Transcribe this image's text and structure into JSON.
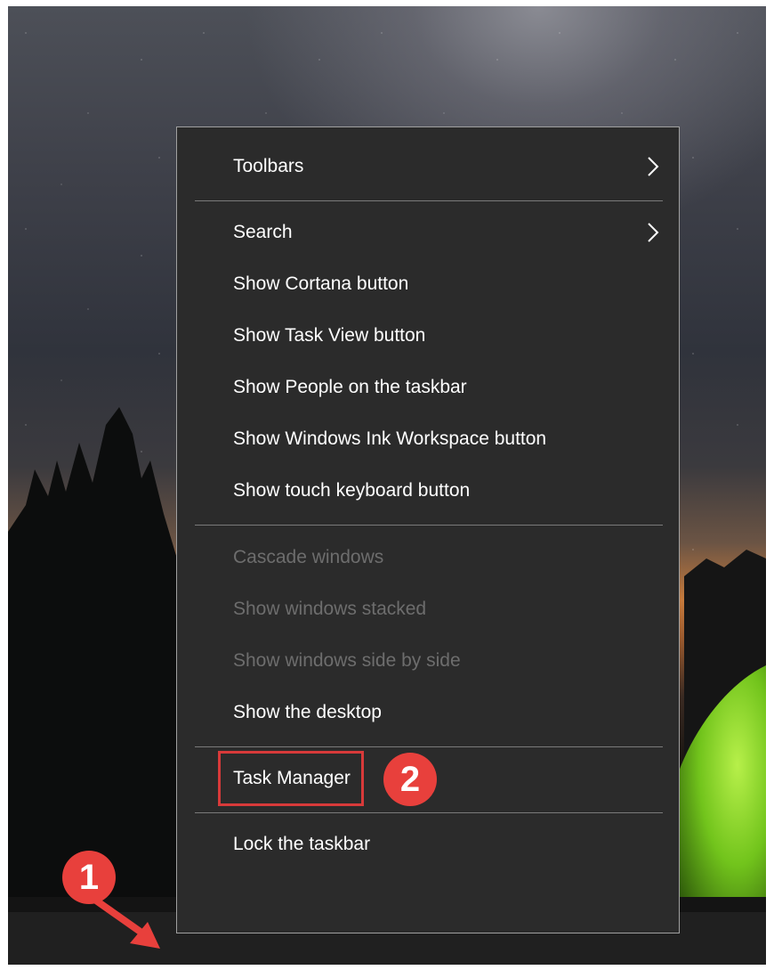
{
  "context_menu": {
    "items": [
      {
        "label": "Toolbars",
        "submenu": true
      },
      {
        "label": "Search",
        "submenu": true
      },
      {
        "label": "Show Cortana button"
      },
      {
        "label": "Show Task View button"
      },
      {
        "label": "Show People on the taskbar"
      },
      {
        "label": "Show Windows Ink Workspace button"
      },
      {
        "label": "Show touch keyboard button"
      },
      {
        "label": "Cascade windows",
        "disabled": true
      },
      {
        "label": "Show windows stacked",
        "disabled": true
      },
      {
        "label": "Show windows side by side",
        "disabled": true
      },
      {
        "label": "Show the desktop"
      },
      {
        "label": "Task Manager",
        "highlighted": true
      },
      {
        "label": "Lock the taskbar"
      }
    ]
  },
  "annotations": {
    "step1": "1",
    "step2": "2",
    "accent_color": "#e8403c"
  },
  "icons": {
    "submenu": "chevron-right-icon",
    "annotation_arrow": "arrow-down-right-icon"
  }
}
